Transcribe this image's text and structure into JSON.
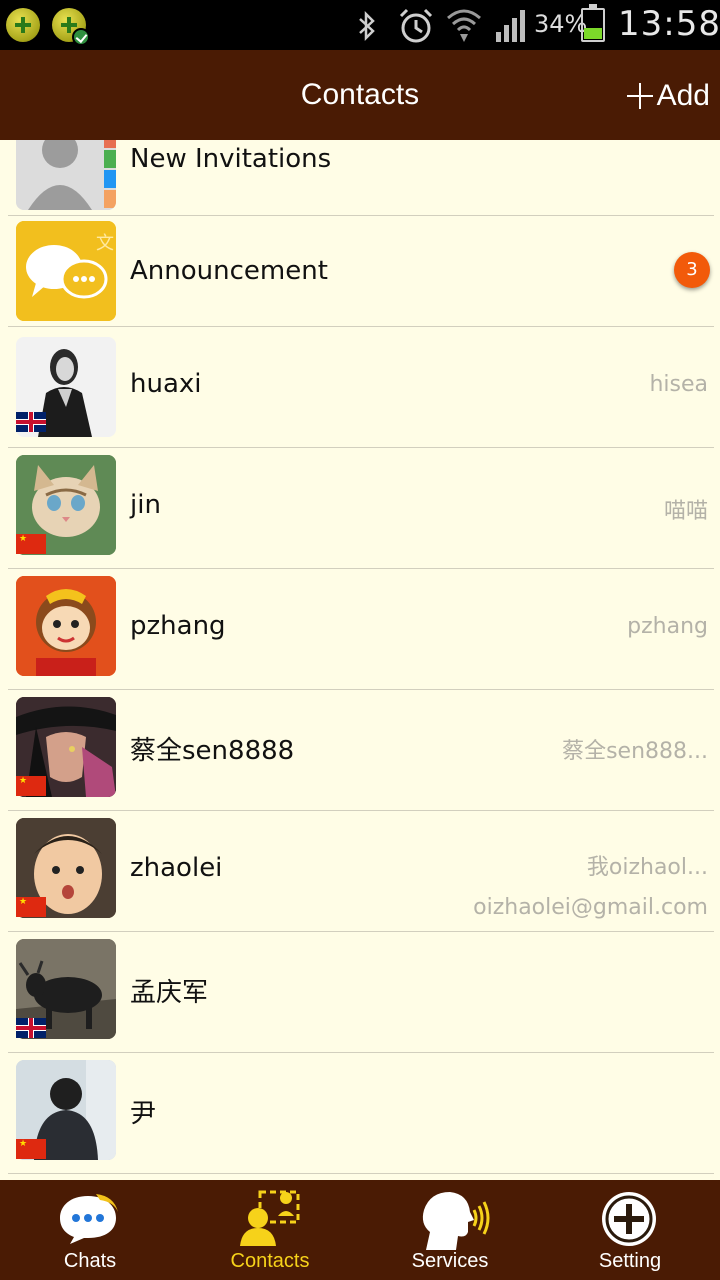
{
  "status_bar": {
    "battery_percent": "34%",
    "time": "13:58"
  },
  "header": {
    "title": "Contacts",
    "add_label": "Add"
  },
  "contacts": [
    {
      "name": "New Invitations",
      "sub": "",
      "avatar": "default-contact-icon"
    },
    {
      "name": "Announcement",
      "sub": "",
      "avatar": "announcement-chat-icon",
      "badge": "3"
    },
    {
      "name": "huaxi",
      "sub": "hisea",
      "flag": "uk"
    },
    {
      "name": "jin",
      "sub": "喵喵",
      "flag": "cn"
    },
    {
      "name": "pzhang",
      "sub": "pzhang"
    },
    {
      "name": "蔡全sen8888",
      "sub": "蔡全sen888...",
      "flag": "cn"
    },
    {
      "name": "zhaolei",
      "sub": "我oizhaol...",
      "sub2": "oizhaolei@gmail.com",
      "flag": "cn"
    },
    {
      "name": "孟庆军",
      "sub": "",
      "flag": "uk"
    },
    {
      "name": "尹",
      "sub": "",
      "flag": "cn"
    }
  ],
  "bottom_nav": [
    {
      "label": "Chats",
      "icon": "chat-bubble-icon"
    },
    {
      "label": "Contacts",
      "icon": "contacts-icon",
      "active": true
    },
    {
      "label": "Services",
      "icon": "services-head-icon"
    },
    {
      "label": "Setting",
      "icon": "plus-circle-icon"
    }
  ],
  "colors": {
    "header_bg": "#4a1b04",
    "list_bg": "#fffde6",
    "active_nav": "#f6d21a",
    "badge": "#f25a0a"
  }
}
